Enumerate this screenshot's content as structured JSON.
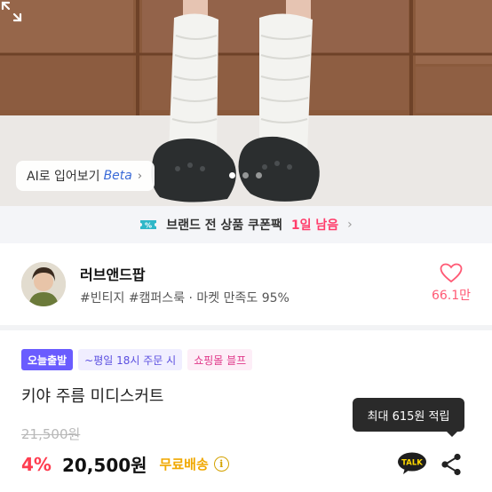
{
  "photo": {
    "ai_try_label": "AI로 입어보기",
    "beta_label": "Beta",
    "page_count": 3,
    "active_page": 1
  },
  "coupon": {
    "text": "브랜드 전 상품 쿠폰팩",
    "remaining": "1일 남음",
    "accent_color": "#ff3d6b"
  },
  "shop": {
    "name": "러브앤드팝",
    "tags": "#빈티지 #캠퍼스룩 · 마켓 만족도 95%",
    "likes": "66.1만"
  },
  "product": {
    "badges": {
      "today": "오늘출발",
      "time": "~평일 18시 주문 시",
      "mall": "쇼핑몰 블프"
    },
    "title": "키야 주름 미디스커트",
    "original_price": "21,500원",
    "discount": "4%",
    "price": "20,500원",
    "shipping": "무료배송",
    "points_tooltip": "최대 615원 적립",
    "talk_label": "TALK"
  },
  "icons": [
    "chevron-right-icon",
    "expand-icon",
    "coupon-ticket-icon",
    "heart-icon",
    "info-icon",
    "kakao-talk-icon",
    "share-icon"
  ],
  "colors": {
    "price_red": "#ff3d50",
    "like_pink": "#ff5a75",
    "shipping_yellow": "#f0a800",
    "today_badge": "#6a5cff"
  }
}
